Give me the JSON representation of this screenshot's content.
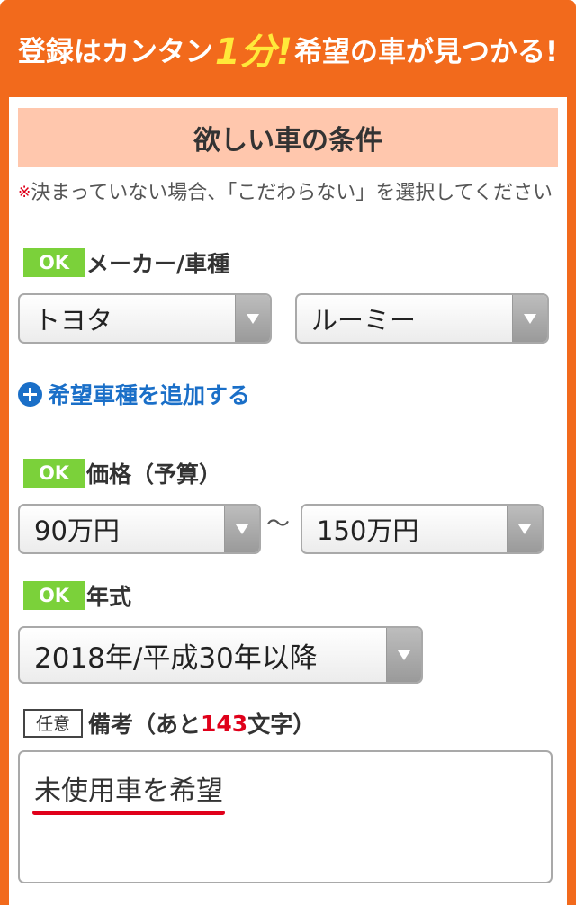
{
  "banner": {
    "text_before": "登録はカンタン",
    "highlight": "1分!",
    "text_after": "希望の車が見つかる!"
  },
  "section": {
    "title": "欲しい車の条件",
    "note_mark": "※",
    "note": "決まっていない場合、「こだわらない」を選択してください"
  },
  "badges": {
    "ok": "OK",
    "optional": "任意"
  },
  "maker": {
    "label": "メーカー/車種",
    "maker_value": "トヨタ",
    "model_value": "ルーミー",
    "add_link": "希望車種を追加する"
  },
  "price": {
    "label": "価格（予算）",
    "min_value": "90万円",
    "separator": "〜",
    "max_value": "150万円"
  },
  "year": {
    "label": "年式",
    "value": "2018年/平成30年以降"
  },
  "remarks": {
    "label_before": "備考（あと",
    "count": "143",
    "label_after": "文字）",
    "value": "未使用車を希望"
  },
  "colors": {
    "accent": "#f26a1c",
    "highlight": "#ffe93a",
    "section_bg": "#ffc7ad",
    "ok_badge": "#7bd13a",
    "link": "#1a6fc8",
    "alert": "#e0001a"
  }
}
